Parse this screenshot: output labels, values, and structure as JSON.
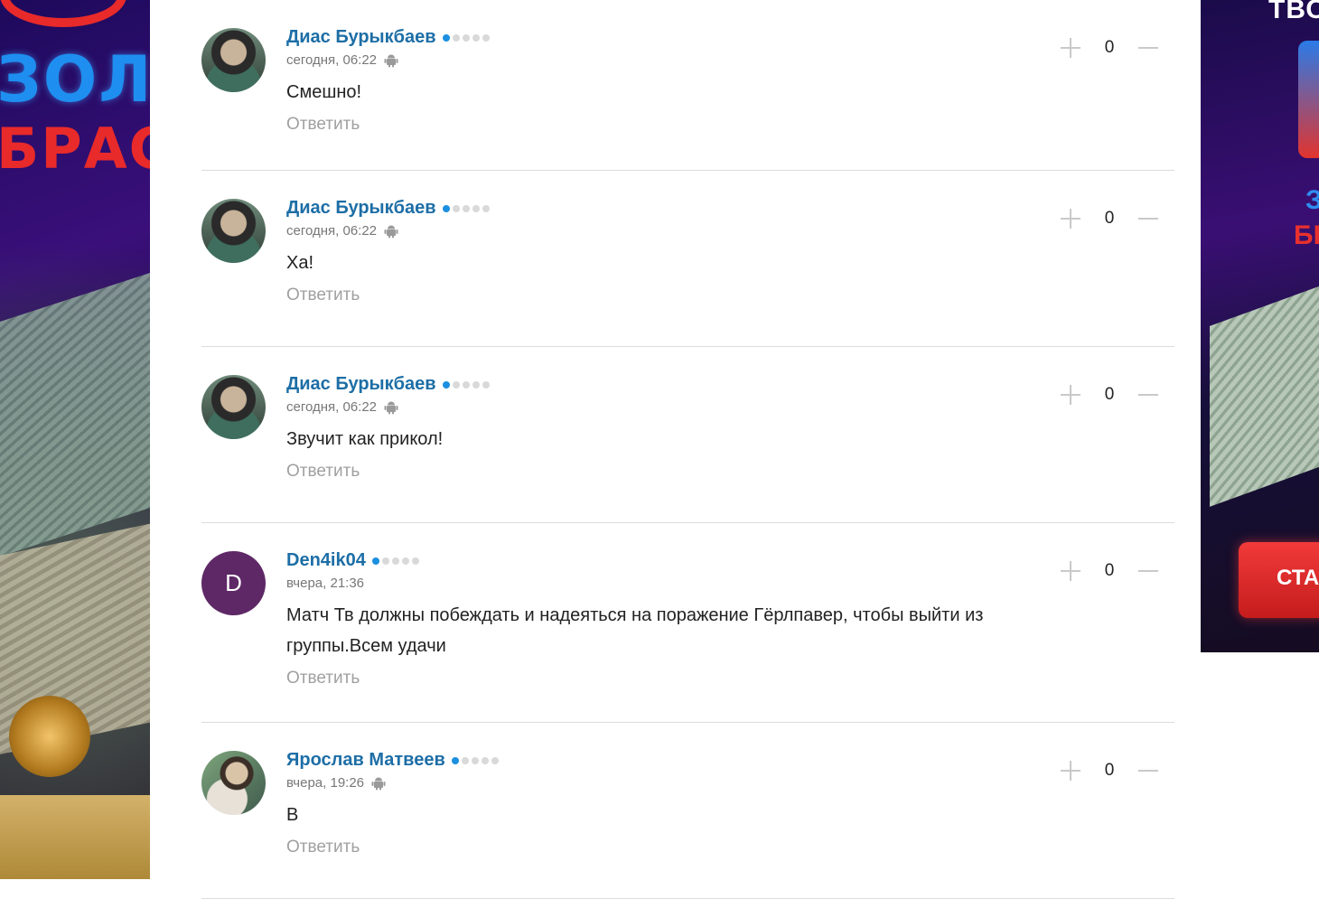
{
  "comments": [
    {
      "author": "Диас Бурыкбаев",
      "time": "сегодня, 06:22",
      "text": "Смешно!",
      "reply": "Ответить",
      "score": "0",
      "avatar": "photo-a",
      "device": "android-icon",
      "level": 1
    },
    {
      "author": "Диас Бурыкбаев",
      "time": "сегодня, 06:22",
      "text": "Ха!",
      "reply": "Ответить",
      "score": "0",
      "avatar": "photo-a",
      "device": "android-icon",
      "level": 1
    },
    {
      "author": "Диас Бурыкбаев",
      "time": "сегодня, 06:22",
      "text": "Звучит как прикол!",
      "reply": "Ответить",
      "score": "0",
      "avatar": "photo-a",
      "device": "android-icon",
      "level": 1
    },
    {
      "author": "Den4ik04",
      "time": "вчера, 21:36",
      "text": "Матч Тв должны побеждать и надеяться на поражение Гёрлпавер, чтобы выйти из группы.Всем удачи",
      "reply": "Ответить",
      "score": "0",
      "avatar": "letter",
      "avatar_letter": "D",
      "level": 1
    },
    {
      "author": "Ярослав Матвеев",
      "time": "вчера, 19:26",
      "text": "В",
      "reply": "Ответить",
      "score": "0",
      "avatar": "photo-b",
      "device": "android-icon",
      "level": 1
    }
  ],
  "ads": {
    "left": {
      "line1": "ЗОЛ",
      "line2": "БРАС"
    },
    "right": {
      "brand": "ТВО",
      "line1": "З",
      "line2": "БІ",
      "cta": "СТА"
    }
  },
  "colors": {
    "author": "#1d6ea6",
    "level_dot": "#1c90e0",
    "reply": "#a0a0a0",
    "divider": "#dcdcdc"
  }
}
